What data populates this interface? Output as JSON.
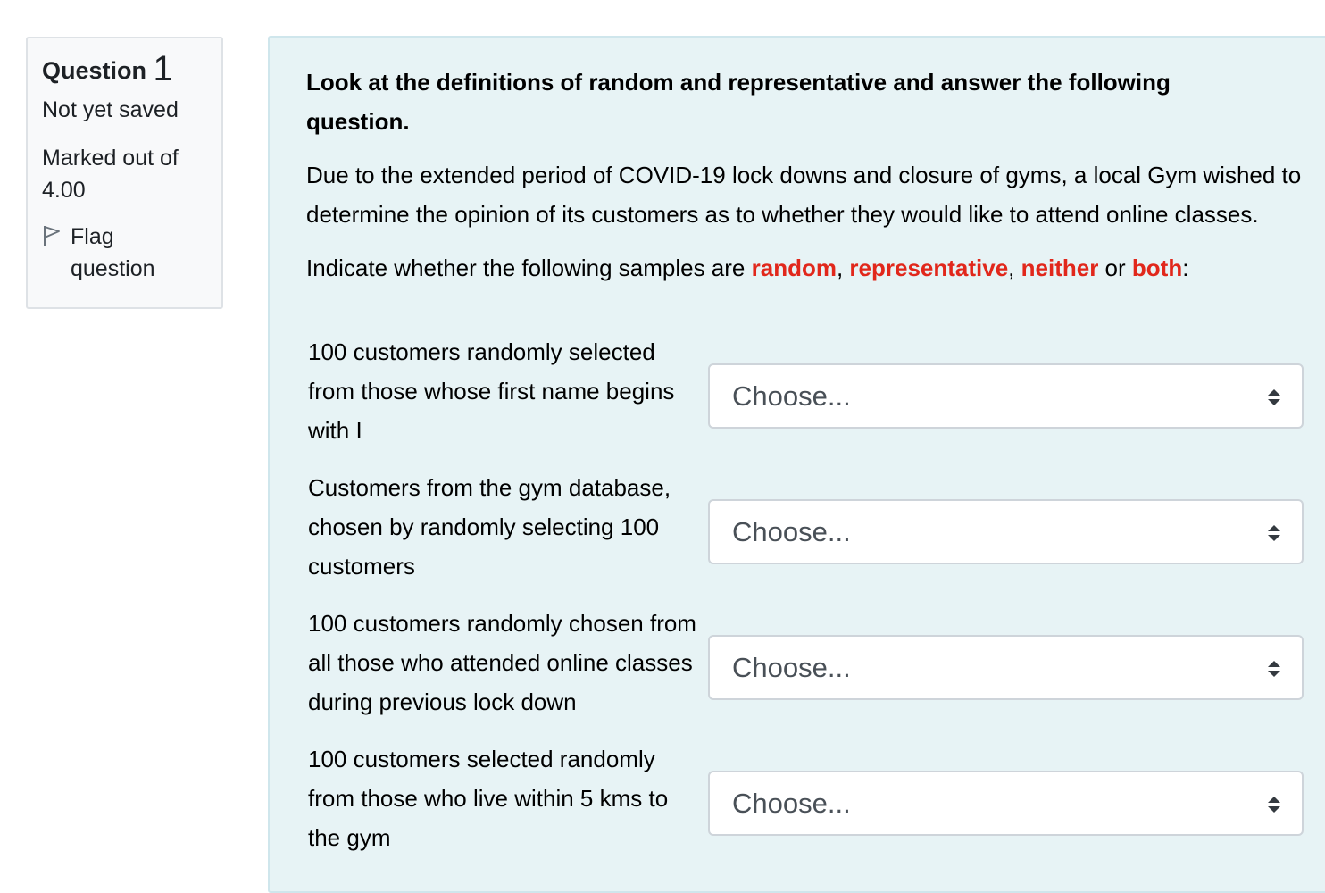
{
  "info": {
    "question_label": "Question",
    "question_number": "1",
    "status": "Not yet saved",
    "marked_line1": "Marked out of",
    "marked_line2": "4.00",
    "flag_line1": "Flag",
    "flag_line2": "question"
  },
  "question": {
    "heading": "Look at the definitions of random and representative and answer the following question.",
    "paragraph1": "Due to the extended period of COVID-19 lock downs and closure of gyms, a local Gym wished to determine the opinion of its customers as to whether they would like to attend online classes.",
    "paragraph2": {
      "prefix": "Indicate whether the following samples are ",
      "term1": "random",
      "sep1": ", ",
      "term2": "representative",
      "sep2": ", ",
      "term3": "neither",
      "sep3": " or ",
      "term4": "both",
      "suffix": ":"
    },
    "items": [
      {
        "label": "100 customers randomly selected from those whose first name begins with I",
        "selected": "Choose..."
      },
      {
        "label": "Customers from the gym database, chosen by randomly selecting 100 customers",
        "selected": "Choose..."
      },
      {
        "label": "100 customers randomly chosen from all those who attended online classes during previous lock down",
        "selected": "Choose..."
      },
      {
        "label": "100 customers selected randomly from those who live within 5 kms to the gym",
        "selected": "Choose..."
      }
    ]
  },
  "colors": {
    "highlight": "#e1271b",
    "panel_background": "#e7f3f5",
    "info_background": "#f8f9fa"
  },
  "icons": {
    "flag": "flag-outline-icon",
    "select_arrows": "up-down-arrows-icon"
  }
}
